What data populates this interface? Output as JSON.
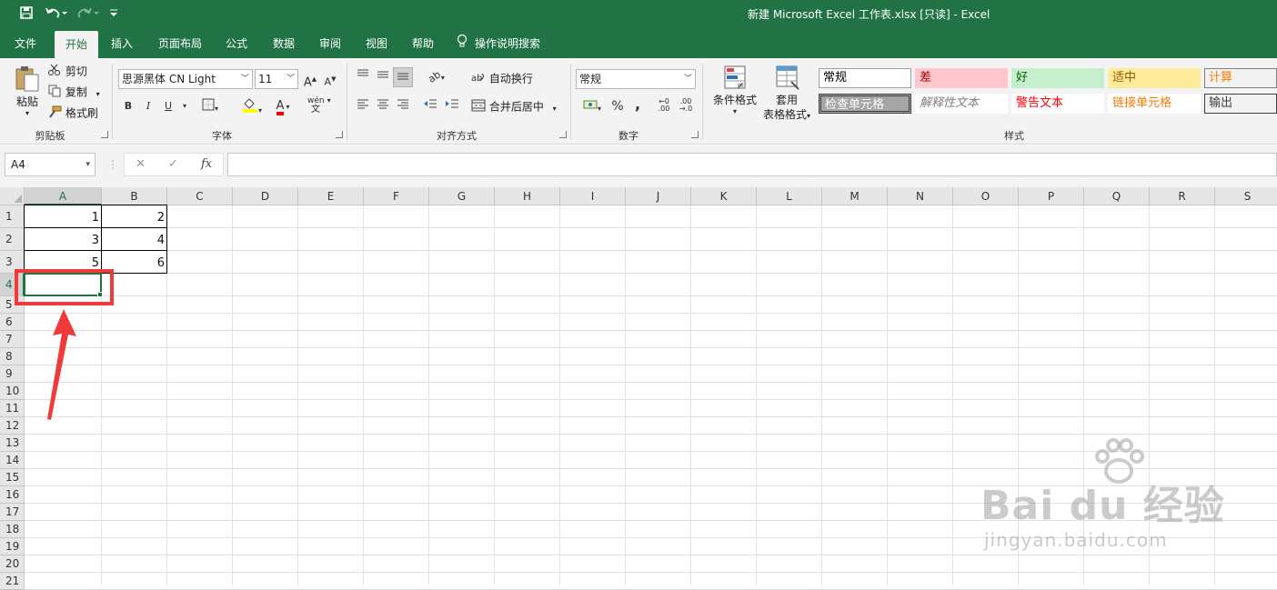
{
  "window": {
    "title": "新建 Microsoft Excel 工作表.xlsx  [只读]  -  Excel"
  },
  "quick_access": {
    "save_icon": "save-icon",
    "undo_icon": "undo-icon",
    "redo_icon": "redo-icon",
    "customize_icon": "customize-qat-icon"
  },
  "tabs": [
    "文件",
    "开始",
    "插入",
    "页面布局",
    "公式",
    "数据",
    "审阅",
    "视图",
    "帮助"
  ],
  "tell_me": "操作说明搜索",
  "ribbon": {
    "clipboard": {
      "label": "剪贴板",
      "paste": "粘贴",
      "cut": "剪切",
      "copy": "复制",
      "format_painter": "格式刷"
    },
    "font": {
      "label": "字体",
      "font_name": "思源黑体 CN Light",
      "font_size": "11",
      "bold": "B",
      "italic": "I",
      "underline": "U",
      "wen": "wén",
      "wen_sub": "文"
    },
    "alignment": {
      "label": "对齐方式",
      "wrap_text": "自动换行",
      "merge_center": "合并后居中"
    },
    "number": {
      "label": "数字",
      "format": "常规",
      "percent": "%",
      "comma": ","
    },
    "styles": {
      "label": "样式",
      "conditional_format": "条件格式",
      "table_format_1": "套用",
      "table_format_2": "表格格式",
      "cells": [
        {
          "text": "常规",
          "bg": "#ffffff",
          "fg": "#000000",
          "border": "#a0a0a0"
        },
        {
          "text": "差",
          "bg": "#ffc7ce",
          "fg": "#9c0006",
          "border": "#ffc7ce"
        },
        {
          "text": "好",
          "bg": "#c6efce",
          "fg": "#006100",
          "border": "#c6efce"
        },
        {
          "text": "适中",
          "bg": "#ffeb9c",
          "fg": "#9c5700",
          "border": "#ffeb9c"
        },
        {
          "text": "计算",
          "bg": "#f2f2f2",
          "fg": "#fa7d00",
          "border": "#7f7f7f"
        },
        {
          "text": "检查单元格",
          "bg": "#a5a5a5",
          "fg": "#ffffff",
          "border": "#3f3f3f"
        },
        {
          "text": "解释性文本",
          "bg": "#ffffff",
          "fg": "#7f7f7f",
          "border": "#ffffff"
        },
        {
          "text": "警告文本",
          "bg": "#ffffff",
          "fg": "#ff0000",
          "border": "#ffffff"
        },
        {
          "text": "链接单元格",
          "bg": "#ffffff",
          "fg": "#fa7d00",
          "border": "#ffffff"
        },
        {
          "text": "输出",
          "bg": "#f2f2f2",
          "fg": "#3f3f3f",
          "border": "#3f3f3f"
        }
      ]
    }
  },
  "formula_bar": {
    "name_box": "A4",
    "cancel": "✕",
    "enter": "✓",
    "fx": "fx",
    "content": ""
  },
  "sheet": {
    "columns": [
      "A",
      "B",
      "C",
      "D",
      "E",
      "F",
      "G",
      "H",
      "I",
      "J",
      "K",
      "L",
      "M",
      "N",
      "O",
      "P",
      "Q",
      "R",
      "S"
    ],
    "rows": [
      "1",
      "2",
      "3",
      "4",
      "5",
      "6",
      "7",
      "8",
      "9",
      "10",
      "11",
      "12",
      "13",
      "14",
      "15",
      "16",
      "17",
      "18",
      "19",
      "20",
      "21"
    ],
    "selected_cell": "A4",
    "values": [
      [
        "1",
        "2"
      ],
      [
        "3",
        "4"
      ],
      [
        "5",
        "6"
      ]
    ]
  },
  "colors": {
    "excel_green": "#217346",
    "annotation_red": "#f03a3a"
  },
  "watermark": {
    "brand": "Bai du 经验",
    "url": "jingyan.baidu.com"
  }
}
